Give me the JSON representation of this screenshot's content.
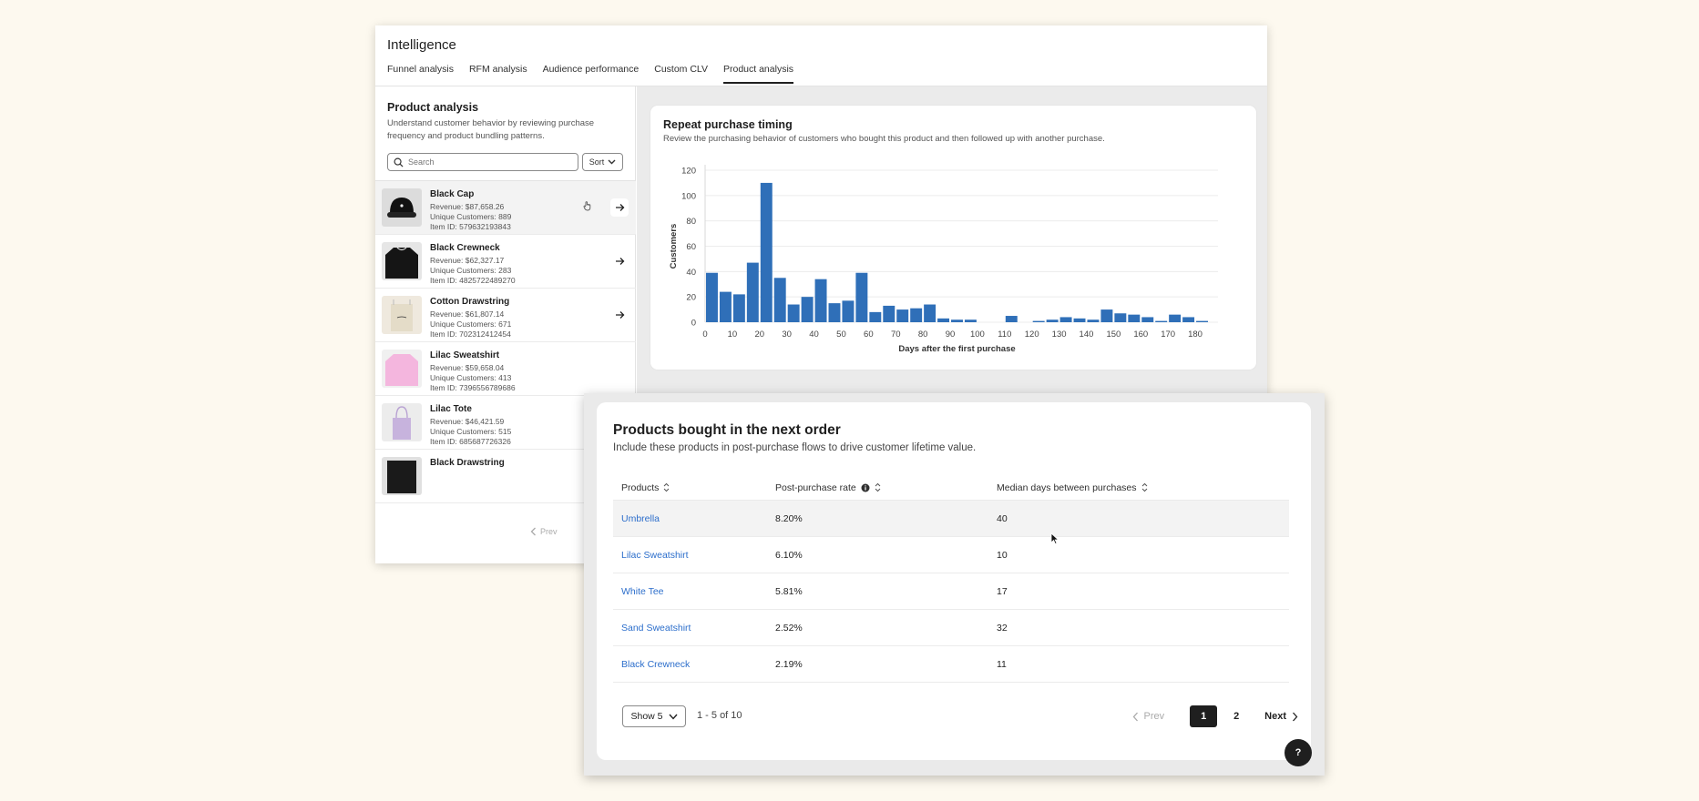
{
  "app": {
    "title": "Intelligence",
    "tabs": [
      "Funnel analysis",
      "RFM analysis",
      "Audience performance",
      "Custom CLV",
      "Product analysis"
    ],
    "active_tab": "Product analysis"
  },
  "sidebar": {
    "title": "Product analysis",
    "description": "Understand customer behavior by reviewing purchase frequency and product bundling patterns.",
    "search_placeholder": "Search",
    "sort_label": "Sort",
    "products": [
      {
        "name": "Black Cap",
        "revenue": "Revenue: $87,658.26",
        "customers": "Unique Customers: 889",
        "item_id": "Item ID: 579632193843",
        "thumb": "black-cap"
      },
      {
        "name": "Black Crewneck",
        "revenue": "Revenue: $62,327.17",
        "customers": "Unique Customers: 283",
        "item_id": "Item ID: 4825722489270",
        "thumb": "black-crewneck"
      },
      {
        "name": "Cotton Drawstring",
        "revenue": "Revenue: $61,807.14",
        "customers": "Unique Customers: 671",
        "item_id": "Item ID: 702312412454",
        "thumb": "cotton-drawstring"
      },
      {
        "name": "Lilac Sweatshirt",
        "revenue": "Revenue: $59,658.04",
        "customers": "Unique Customers: 413",
        "item_id": "Item ID: 7396556789686",
        "thumb": "lilac-sweatshirt"
      },
      {
        "name": "Lilac Tote",
        "revenue": "Revenue: $46,421.59",
        "customers": "Unique Customers: 515",
        "item_id": "Item ID: 685687726326",
        "thumb": "lilac-tote"
      },
      {
        "name": "Black Drawstring",
        "revenue": "",
        "customers": "",
        "item_id": "",
        "thumb": "black-drawstring"
      }
    ],
    "pager_prev": "Prev"
  },
  "repeat_chart": {
    "title": "Repeat purchase timing",
    "subtitle": "Review the purchasing behavior of customers who bought this product and then followed up with another purchase."
  },
  "chart_data": {
    "type": "bar",
    "title": "Repeat purchase timing",
    "xlabel": "Days after the first purchase",
    "ylabel": "Customers",
    "ylim": [
      0,
      120
    ],
    "yticks": [
      0,
      20,
      40,
      60,
      80,
      100,
      120
    ],
    "xlim": [
      0,
      185
    ],
    "xticks": [
      0,
      10,
      20,
      30,
      40,
      50,
      60,
      70,
      80,
      90,
      100,
      110,
      120,
      130,
      140,
      150,
      160,
      170,
      180
    ],
    "bin_width": 5,
    "x": [
      0,
      5,
      10,
      15,
      20,
      25,
      30,
      35,
      40,
      45,
      50,
      55,
      60,
      65,
      70,
      75,
      80,
      85,
      90,
      95,
      100,
      105,
      110,
      115,
      120,
      125,
      130,
      135,
      140,
      145,
      150,
      155,
      160,
      165,
      170,
      175,
      180
    ],
    "values": [
      39,
      24,
      22,
      47,
      110,
      35,
      14,
      20,
      34,
      15,
      17,
      39,
      8,
      13,
      10,
      11,
      14,
      3,
      2,
      2,
      0,
      0,
      5,
      0,
      1,
      2,
      4,
      3,
      2,
      10,
      7,
      6,
      4,
      1,
      6,
      4,
      1
    ],
    "color": "#2f6fb8",
    "grid": true
  },
  "next_order": {
    "title": "Products bought in the next order",
    "subtitle": "Include these products in post-purchase flows to drive customer lifetime value.",
    "columns": [
      "Products",
      "Post-purchase rate",
      "Median days between purchases"
    ],
    "rows": [
      {
        "product": "Umbrella",
        "rate": "8.20%",
        "days": "40"
      },
      {
        "product": "Lilac Sweatshirt",
        "rate": "6.10%",
        "days": "10"
      },
      {
        "product": "White Tee",
        "rate": "5.81%",
        "days": "17"
      },
      {
        "product": "Sand Sweatshirt",
        "rate": "2.52%",
        "days": "32"
      },
      {
        "product": "Black Crewneck",
        "rate": "2.19%",
        "days": "11"
      }
    ],
    "show_label": "Show 5",
    "range_label": "1 - 5 of 10",
    "prev_label": "Prev",
    "pages": [
      "1",
      "2"
    ],
    "next_label": "Next"
  },
  "help_label": "?"
}
